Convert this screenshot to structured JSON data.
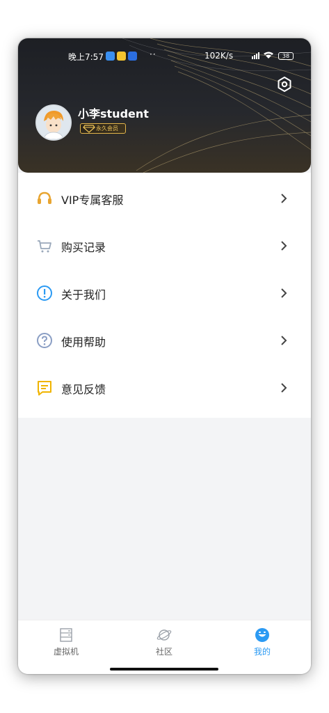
{
  "status_bar": {
    "time": "晚上7:57",
    "dots": "··",
    "network_speed": "102K/s",
    "battery": "38"
  },
  "profile": {
    "username": "小李student",
    "badge": "永久会员"
  },
  "menu": {
    "items": [
      {
        "label": "VIP专属客服",
        "icon": "headset-icon",
        "color": "#e8a531"
      },
      {
        "label": "购买记录",
        "icon": "cart-icon",
        "color": "#9aa8ba"
      },
      {
        "label": "关于我们",
        "icon": "info-icon",
        "color": "#2b9af3"
      },
      {
        "label": "使用帮助",
        "icon": "help-icon",
        "color": "#8a9ec4"
      },
      {
        "label": "意见反馈",
        "icon": "feedback-icon",
        "color": "#f0b400"
      }
    ]
  },
  "tabbar": {
    "tabs": [
      {
        "label": "虚拟机",
        "icon": "server-icon"
      },
      {
        "label": "社区",
        "icon": "planet-icon"
      },
      {
        "label": "我的",
        "icon": "smile-icon",
        "active": true
      }
    ]
  },
  "colors": {
    "accent": "#2b9af3",
    "header_bg": "#1d1f24",
    "gold": "#e4b64b"
  }
}
